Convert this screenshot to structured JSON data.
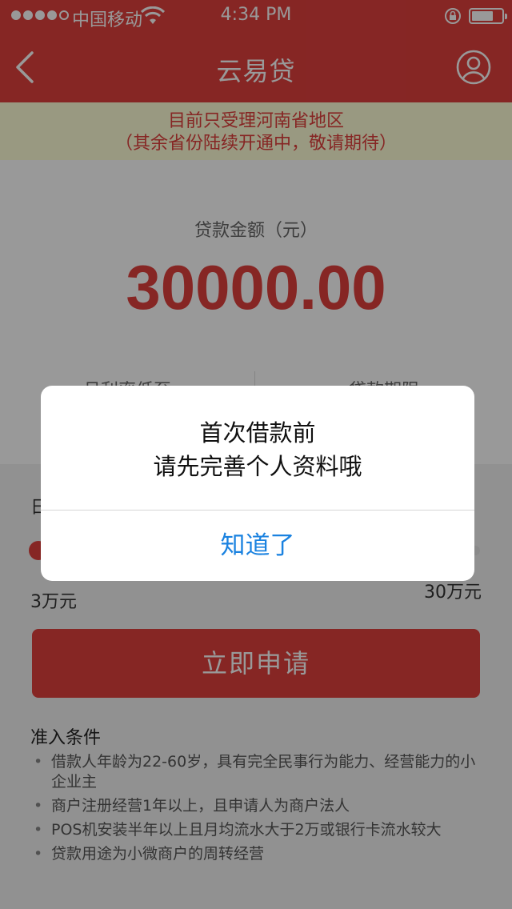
{
  "status_bar": {
    "carrier": "中国移动",
    "time": "4:34 PM"
  },
  "nav": {
    "title": "云易贷",
    "back_icon": "chevron-left-icon",
    "user_icon": "user-circle-icon"
  },
  "notice": {
    "line1": "目前只受理河南省地区",
    "line2": "（其余省份陆续开通中，敬请期待）"
  },
  "loan": {
    "amount_label": "贷款金额（元）",
    "amount_value": "30000.00",
    "stat_left_label": "月利率低至",
    "stat_right_label": "贷款期限"
  },
  "slider": {
    "title_partial": "日",
    "min_label": "3万元",
    "max_label": "30万元",
    "fill_percent": 0
  },
  "apply_button": "立即申请",
  "conditions": {
    "title": "准入条件",
    "items": [
      "借款人年龄为22-60岁，具有完全民事行为能力、经营能力的小企业主",
      "商户注册经营1年以上，且申请人为商户法人",
      "POS机安装半年以上且月均流水大于2万或银行卡流水较大",
      "贷款用途为小微商户的周转经营"
    ]
  },
  "modal": {
    "line1": "首次借款前",
    "line2": "请先完善个人资料哦",
    "button": "知道了"
  },
  "colors": {
    "brand": "#e0403d",
    "link": "#1a82e0",
    "notice_bg": "#ffffd8"
  }
}
